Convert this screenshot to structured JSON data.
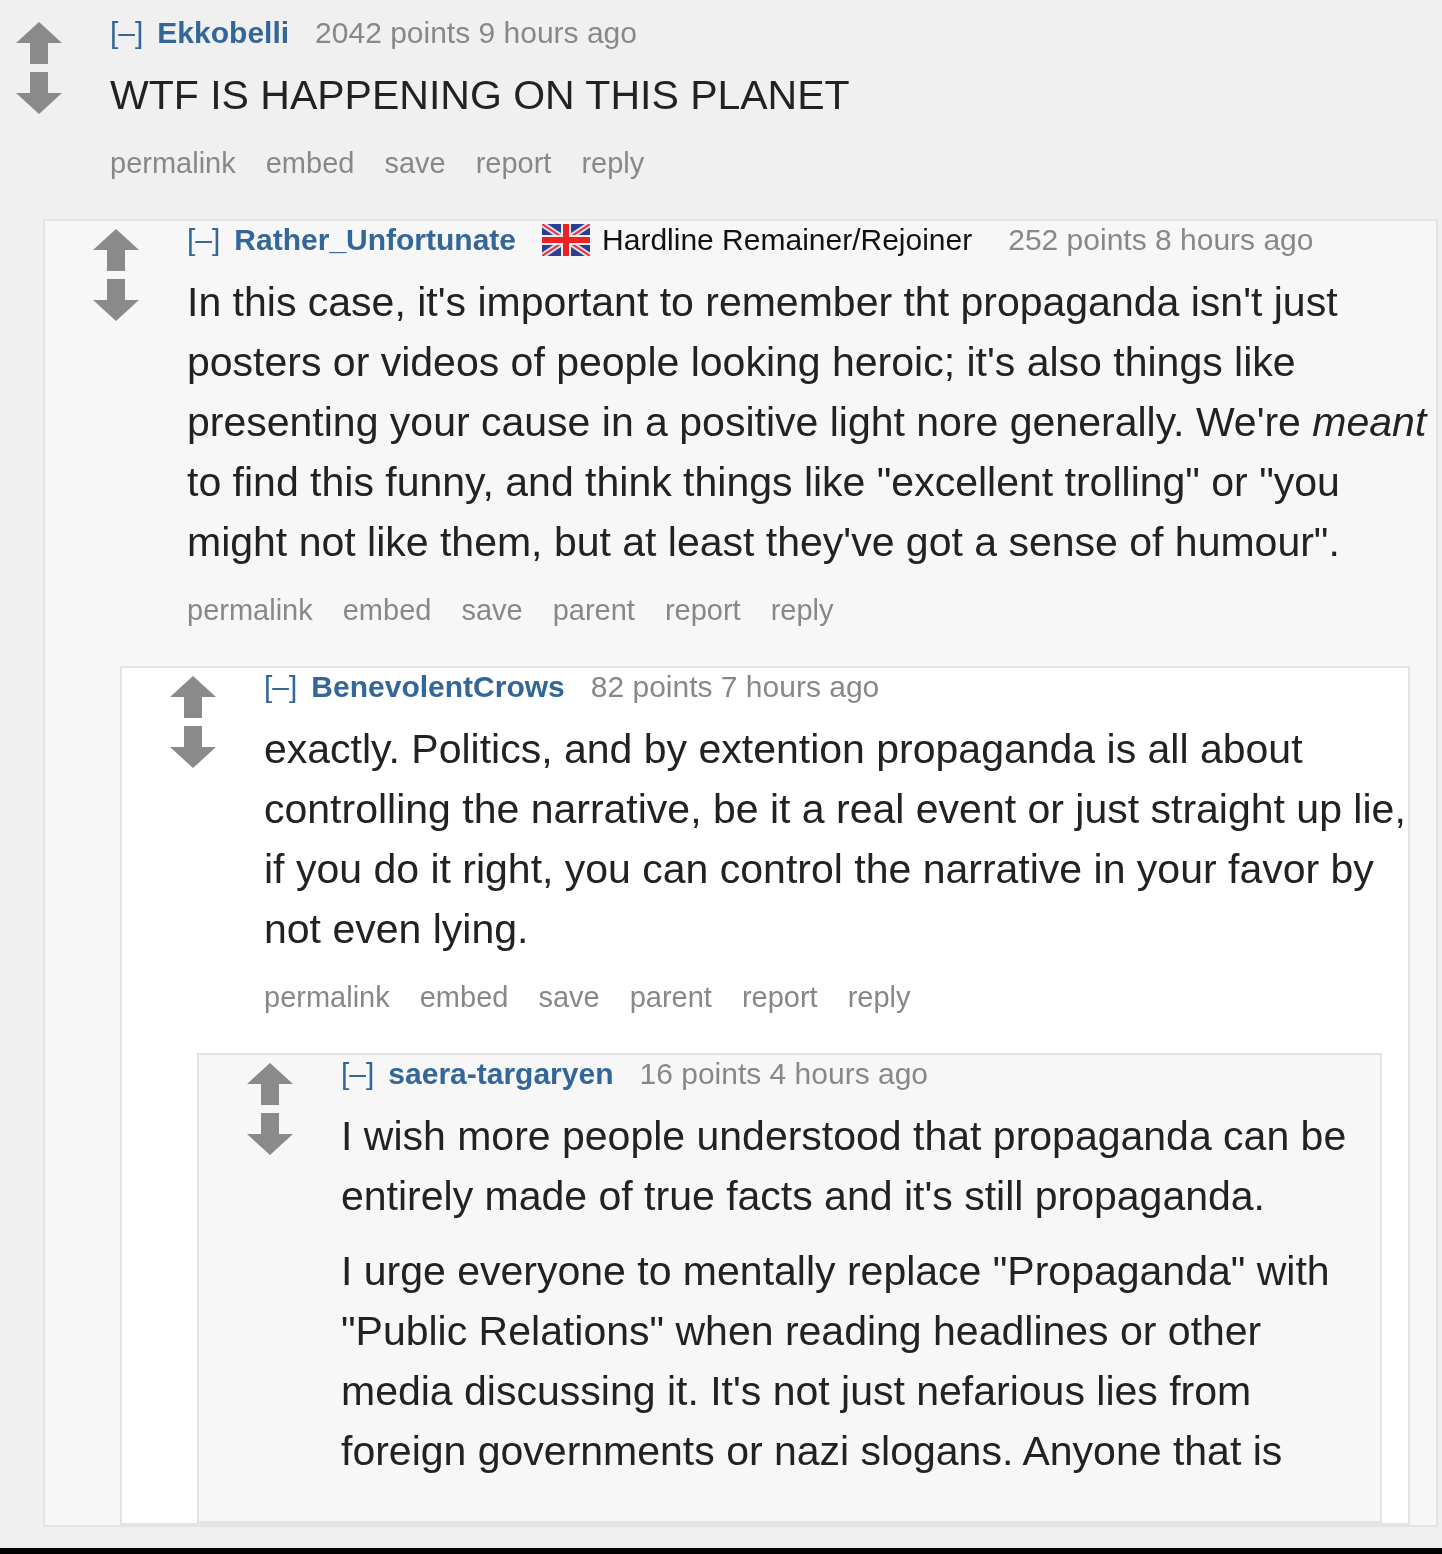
{
  "comments": [
    {
      "collapse": "[–]",
      "author": "Ekkobelli",
      "score": "2042 points",
      "time": "9 hours ago",
      "paragraphs": [
        "WTF IS HAPPENING ON THIS PLANET"
      ],
      "actions": [
        "permalink",
        "embed",
        "save",
        "report",
        "reply"
      ],
      "children": [
        {
          "collapse": "[–]",
          "author": "Rather_Unfortunate",
          "flair": {
            "text": "Hardline Remainer/Rejoiner"
          },
          "score": "252 points",
          "time": "8 hours ago",
          "paragraphs": [
            "In this case, it's important to remember tht propaganda isn't just posters or videos of people looking heroic; it's also things like presenting your cause in a positive light nore generally. We're *meant* to find this funny, and think things like \"excellent trolling\" or \"you might not like them, but at least they've got a sense of humour\"."
          ],
          "actions": [
            "permalink",
            "embed",
            "save",
            "parent",
            "report",
            "reply"
          ],
          "children": [
            {
              "collapse": "[–]",
              "author": "BenevolentCrows",
              "score": "82 points",
              "time": "7 hours ago",
              "paragraphs": [
                "exactly. Politics, and by extention propaganda is all about controlling the narrative, be it a real event or just straight up lie, if you do it right, you can control the narrative in your favor by not even lying."
              ],
              "actions": [
                "permalink",
                "embed",
                "save",
                "parent",
                "report",
                "reply"
              ],
              "children": [
                {
                  "collapse": "[–]",
                  "author": "saera-targaryen",
                  "score": "16 points",
                  "time": "4 hours ago",
                  "paragraphs": [
                    "I wish more people understood that propaganda can be entirely made of true facts and it's still propaganda.",
                    "I urge everyone to mentally replace \"Propaganda\" with \"Public Relations\" when reading headlines or other media discussing it. It's not just nefarious lies from foreign governments or nazi slogans. Anyone that is"
                  ]
                }
              ]
            }
          ]
        }
      ]
    }
  ]
}
